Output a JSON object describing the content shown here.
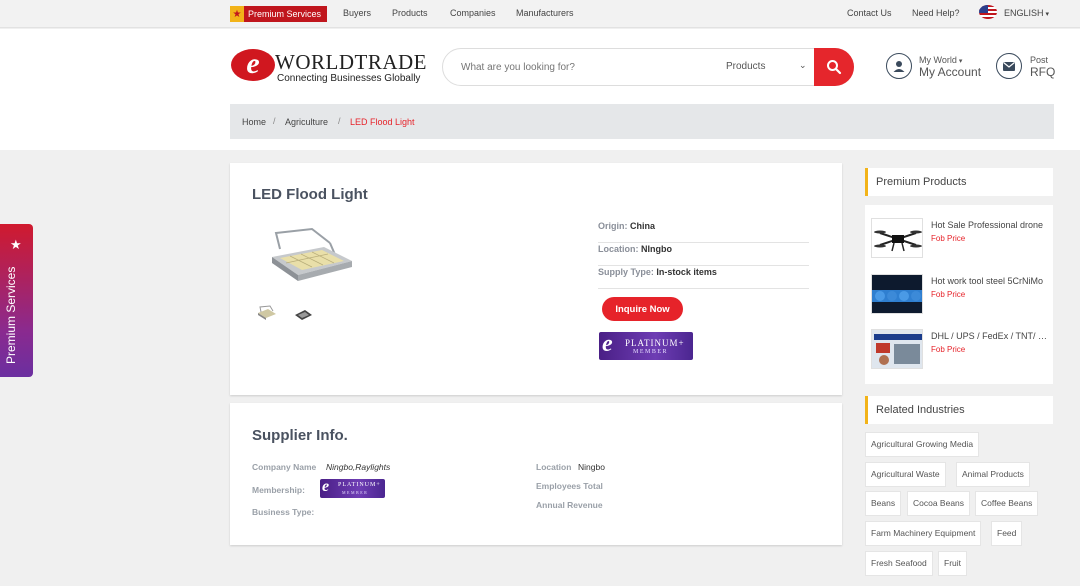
{
  "topbar": {
    "premium_services": "Premium Services",
    "nav": [
      "Buyers",
      "Products",
      "Companies",
      "Manufacturers"
    ],
    "contact": "Contact Us",
    "help": "Need Help?",
    "language": "ENGLISH"
  },
  "header": {
    "logo_letter": "e",
    "logo_title": "WORLDTRADE",
    "logo_tagline": "Connecting Businesses Globally",
    "search_placeholder": "What are you looking for?",
    "search_category": "Products",
    "my_world": "My World",
    "my_account": "My Account",
    "post": "Post",
    "rfq": "RFQ"
  },
  "breadcrumb": {
    "home": "Home",
    "category": "Agriculture",
    "current": "LED Flood Light"
  },
  "product": {
    "title": "LED Flood Light",
    "origin_label": "Origin:",
    "origin": "China",
    "location_label": "Location:",
    "location": "NIngbo",
    "supply_label": "Supply Type:",
    "supply": "In-stock items",
    "inquire": "Inquire Now"
  },
  "platinum_badge": {
    "letter": "e",
    "title": "PLATINUM+",
    "subtitle": "MEMBER"
  },
  "supplier": {
    "title": "Supplier Info.",
    "company_label": "Company Name",
    "company": "Ningbo,Raylights",
    "membership_label": "Membership:",
    "business_type_label": "Business Type:",
    "location_label": "Location",
    "location": "Ningbo",
    "employees_label": "Employees Total",
    "revenue_label": "Annual Revenue"
  },
  "sidebar": {
    "premium_title": "Premium Products",
    "products": [
      {
        "name": "Hot Sale Professional drone",
        "price": "Fob Price"
      },
      {
        "name": "Hot work tool steel 5CrNiMo",
        "price": "Fob Price"
      },
      {
        "name": "DHL / UPS / FedEx / TNT/ EMS",
        "price": "Fob Price"
      }
    ],
    "industries_title": "Related Industries",
    "industries": [
      "Agricultural Growing Media",
      "Agricultural Waste",
      "Animal Products",
      "Beans",
      "Cocoa Beans",
      "Coffee Beans",
      "Farm Machinery Equipment",
      "Feed",
      "Fresh Seafood",
      "Fruit"
    ]
  },
  "side_tab": "Premium Services",
  "colors": {
    "brand_red": "#e6232a",
    "accent_yellow": "#f2b319",
    "platinum_purple": "#5a2d9c"
  }
}
